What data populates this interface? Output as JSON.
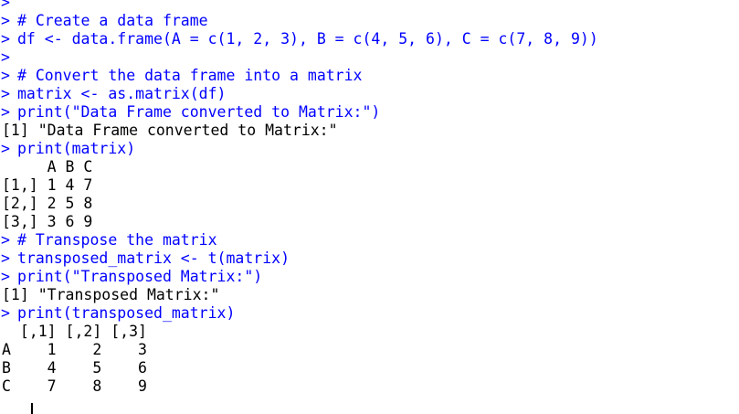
{
  "console": {
    "prompt_symbol": ">",
    "lines": [
      {
        "type": "prompt",
        "text": ""
      },
      {
        "type": "prompt",
        "text": "# Create a data frame"
      },
      {
        "type": "prompt",
        "text": "df <- data.frame(A = c(1, 2, 3), B = c(4, 5, 6), C = c(7, 8, 9))"
      },
      {
        "type": "prompt",
        "text": ""
      },
      {
        "type": "prompt",
        "text": "# Convert the data frame into a matrix"
      },
      {
        "type": "prompt",
        "text": "matrix <- as.matrix(df)"
      },
      {
        "type": "prompt",
        "text": "print(\"Data Frame converted to Matrix:\")"
      },
      {
        "type": "output",
        "text": "[1] \"Data Frame converted to Matrix:\""
      },
      {
        "type": "prompt",
        "text": "print(matrix)"
      },
      {
        "type": "output",
        "text": "     A B C"
      },
      {
        "type": "output",
        "text": "[1,] 1 4 7"
      },
      {
        "type": "output",
        "text": "[2,] 2 5 8"
      },
      {
        "type": "output",
        "text": "[3,] 3 6 9"
      },
      {
        "type": "prompt",
        "text": "# Transpose the matrix"
      },
      {
        "type": "prompt",
        "text": "transposed_matrix <- t(matrix)"
      },
      {
        "type": "prompt",
        "text": "print(\"Transposed Matrix:\")"
      },
      {
        "type": "output",
        "text": "[1] \"Transposed Matrix:\""
      },
      {
        "type": "prompt",
        "text": "print(transposed_matrix)"
      },
      {
        "type": "output",
        "text": "  [,1] [,2] [,3]"
      },
      {
        "type": "output",
        "text": "A    1    2    3"
      },
      {
        "type": "output",
        "text": "B    4    5    6"
      },
      {
        "type": "output",
        "text": "C    7    8    9"
      }
    ]
  },
  "colors": {
    "input": "#0000ff",
    "output": "#000000",
    "background": "#ffffff"
  }
}
